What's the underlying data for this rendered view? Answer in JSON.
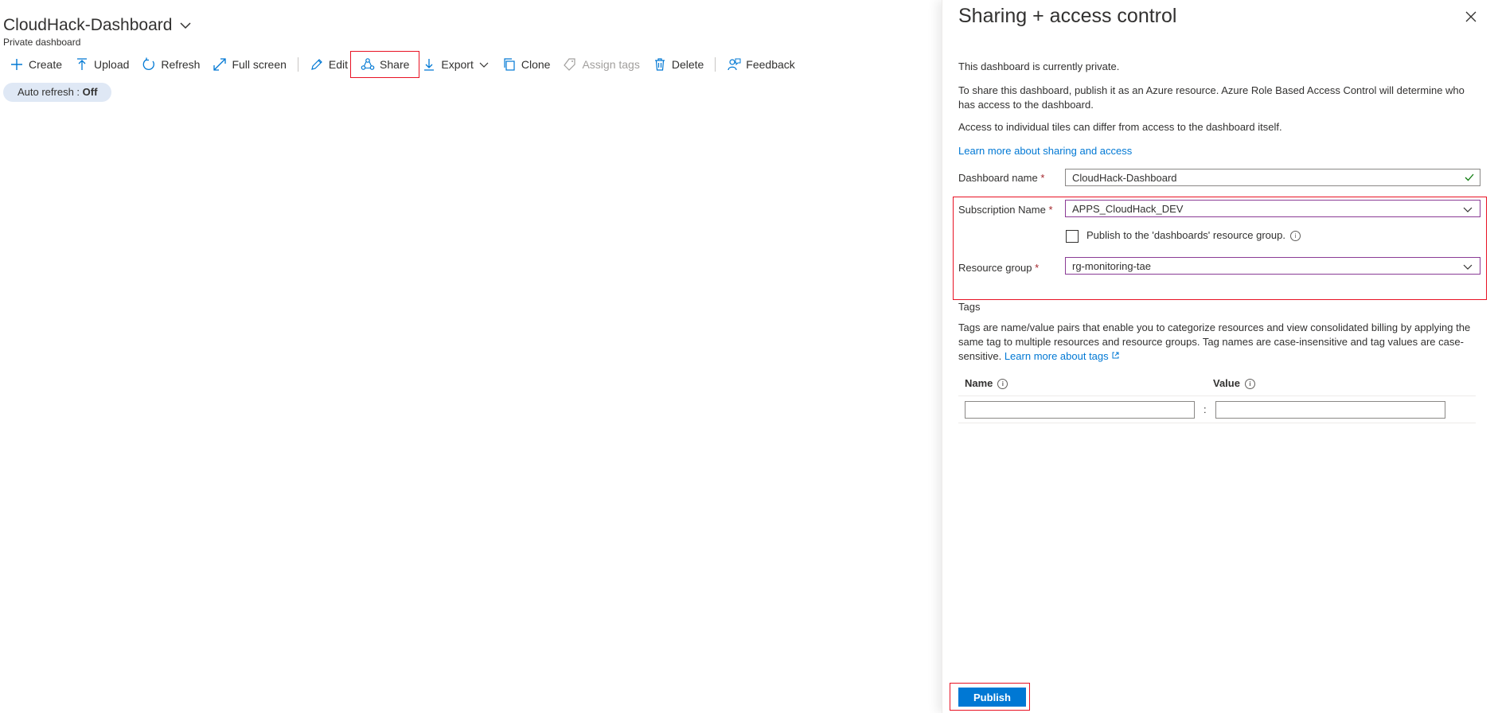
{
  "dashboard": {
    "title": "CloudHack-Dashboard",
    "subtitle": "Private dashboard",
    "toolbar": [
      {
        "label": "Create",
        "icon": "plus-icon"
      },
      {
        "label": "Upload",
        "icon": "upload-icon"
      },
      {
        "label": "Refresh",
        "icon": "refresh-icon"
      },
      {
        "label": "Full screen",
        "icon": "fullscreen-icon"
      },
      {
        "label": "Edit",
        "icon": "pencil-icon"
      },
      {
        "label": "Share",
        "icon": "share-icon"
      },
      {
        "label": "Export",
        "icon": "download-icon"
      },
      {
        "label": "Clone",
        "icon": "clone-icon"
      },
      {
        "label": "Assign tags",
        "icon": "tag-icon"
      },
      {
        "label": "Delete",
        "icon": "trash-icon"
      },
      {
        "label": "Feedback",
        "icon": "feedback-icon"
      }
    ],
    "auto_refresh_label": "Auto refresh : ",
    "auto_refresh_value": "Off"
  },
  "panel": {
    "title": "Sharing + access control",
    "status_text": "This dashboard is currently private.",
    "info_text": "To share this dashboard, publish it as an Azure resource. Azure Role Based Access Control will determine who has access to the dashboard.",
    "tiles_text": "Access to individual tiles can differ from access to the dashboard itself.",
    "learn_link": "Learn more about sharing and access",
    "dashboard_name_label": "Dashboard name",
    "dashboard_name_value": "CloudHack-Dashboard",
    "subscription_label": "Subscription Name",
    "subscription_value": "APPS_CloudHack_DEV",
    "publish_rg_label": "Publish to the 'dashboards' resource group.",
    "resource_group_label": "Resource group",
    "resource_group_value": "rg-monitoring-tae",
    "required_mark": "*",
    "tags_heading": "Tags",
    "tags_text": "Tags are name/value pairs that enable you to categorize resources and view consolidated billing by applying the same tag to multiple resources and resource groups. Tag names are case-insensitive and tag values are case-sensitive.",
    "tags_link": "Learn more about tags",
    "tags_name_header": "Name",
    "tags_value_header": "Value",
    "tags_separator": ":",
    "publish_button": "Publish"
  },
  "colors": {
    "accent": "#0078d4",
    "highlight": "#e81123",
    "required": "#a4262c",
    "pill": "#dfe8f5"
  }
}
